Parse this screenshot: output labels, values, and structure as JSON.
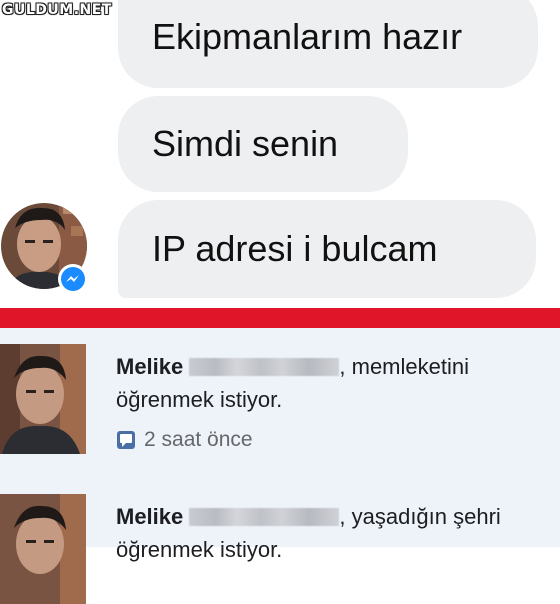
{
  "watermark": "GULDUM.NET",
  "chat": {
    "messages": [
      {
        "text": "Ekipmanlarım hazır"
      },
      {
        "text": "Simdi senin"
      },
      {
        "text": "IP adresi i bulcam"
      }
    ],
    "badge_icon": "messenger-icon"
  },
  "notifications": [
    {
      "sender": "Melike",
      "text": ", memleketini öğrenmek istiyor.",
      "time": "2 saat önce",
      "icon": "comment-icon"
    },
    {
      "sender": "Melike",
      "text": ", yaşadığın şehri öğrenmek istiyor."
    }
  ],
  "colors": {
    "divider": "#e0152a",
    "bubble": "#eeeff1",
    "notification_bg": "#eef2f9",
    "messenger_blue": "#1a8cff"
  }
}
